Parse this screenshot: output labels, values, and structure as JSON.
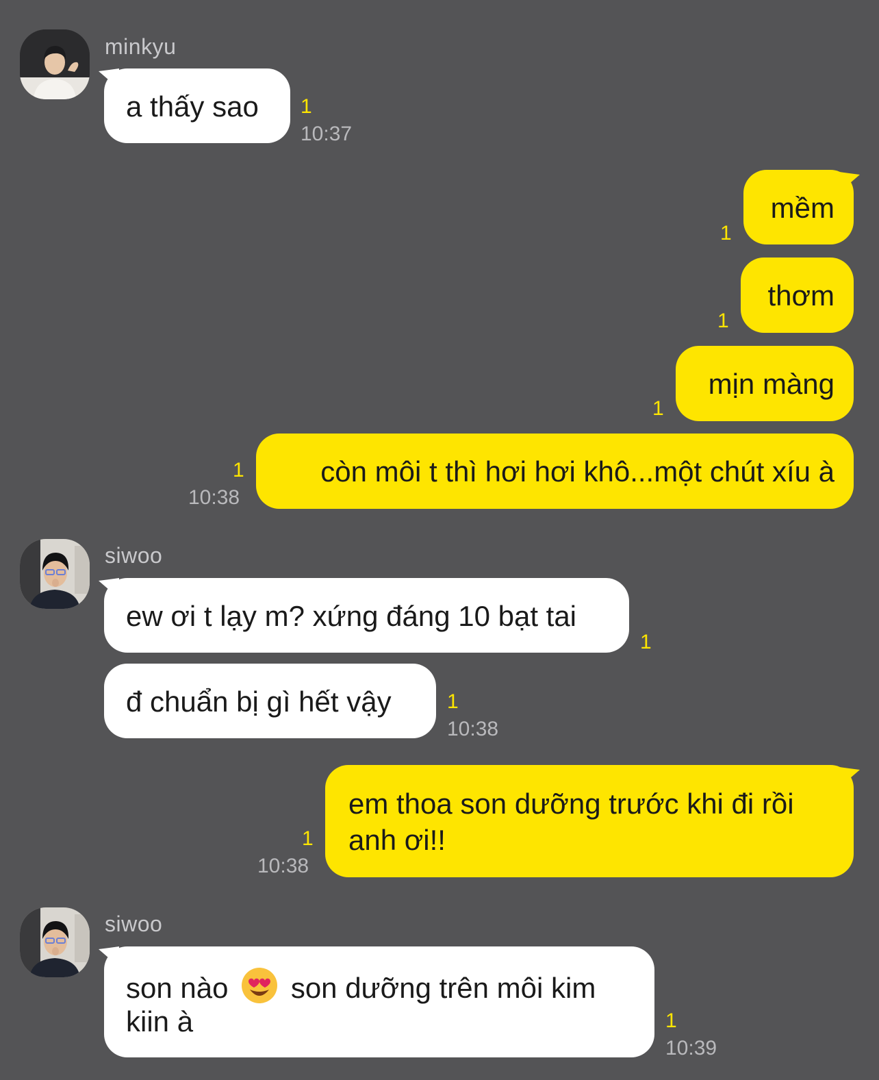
{
  "colors": {
    "background": "#545456",
    "incoming_bubble": "#ffffff",
    "outgoing_bubble": "#fee500",
    "unread_count": "#fee500",
    "timestamp": "#b9b9bc"
  },
  "messages": [
    {
      "sender": "minkyu",
      "avatar": "minkyu-avatar",
      "text": "a thấy sao",
      "unread": "1",
      "time": "10:37"
    },
    {
      "text": "mềm",
      "unread": "1"
    },
    {
      "text": "thơm",
      "unread": "1"
    },
    {
      "text": "mịn màng",
      "unread": "1"
    },
    {
      "text": "còn môi t thì hơi hơi khô...một chút xíu à",
      "unread": "1",
      "time": "10:38"
    },
    {
      "sender": "siwoo",
      "avatar": "siwoo-avatar",
      "text": "ew ơi t lạy m? xứng đáng 10 bạt tai",
      "unread": "1"
    },
    {
      "text": "đ chuẩn bị gì hết vậy",
      "unread": "1",
      "time": "10:38"
    },
    {
      "line1": "em thoa son dưỡng trước khi đi rồi",
      "line2": "anh ơi!!",
      "unread": "1",
      "time": "10:38"
    },
    {
      "sender": "siwoo",
      "avatar": "siwoo-avatar",
      "line1_a": "son nào",
      "emoji": "heart-eyes-emoji",
      "line1_b": "son dưỡng trên môi kim",
      "line2": "kiin à",
      "unread": "1",
      "time": "10:39"
    }
  ]
}
